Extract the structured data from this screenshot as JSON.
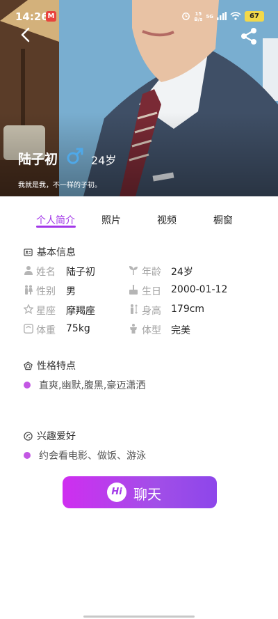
{
  "status_bar": {
    "time": "14:26",
    "app_badge": "M",
    "net_speed_top": "15",
    "net_speed_bottom": "B/s",
    "signal": "5G",
    "battery": "67"
  },
  "profile": {
    "name": "陆子初",
    "gender_symbol": "♂",
    "age": "24岁",
    "bio": "我就是我，不一样的子初。"
  },
  "tabs": [
    {
      "label": "个人简介",
      "active": true
    },
    {
      "label": "照片",
      "active": false
    },
    {
      "label": "视频",
      "active": false
    },
    {
      "label": "橱窗",
      "active": false
    }
  ],
  "basic_info": {
    "title": "基本信息",
    "rows": [
      {
        "left_label": "姓名",
        "left_value": "陆子初",
        "right_label": "年龄",
        "right_value": "24岁"
      },
      {
        "left_label": "性别",
        "left_value": "男",
        "right_label": "生日",
        "right_value": "2000-01-12"
      },
      {
        "left_label": "星座",
        "left_value": "摩羯座",
        "right_label": "身高",
        "right_value": "179cm"
      },
      {
        "left_label": "体重",
        "left_value": "75kg",
        "right_label": "体型",
        "right_value": "完美"
      }
    ]
  },
  "personality": {
    "title": "性格特点",
    "text": "直爽,幽默,腹黑,豪迈潇洒"
  },
  "hobbies": {
    "title": "兴趣爱好",
    "text": "约会看电影、做饭、游泳"
  },
  "chat_button": {
    "badge": "Hi",
    "label": "聊天"
  },
  "colors": {
    "accent": "#a237e8",
    "bullet": "#c357e4",
    "gender_blue": "#4fa8e8"
  }
}
